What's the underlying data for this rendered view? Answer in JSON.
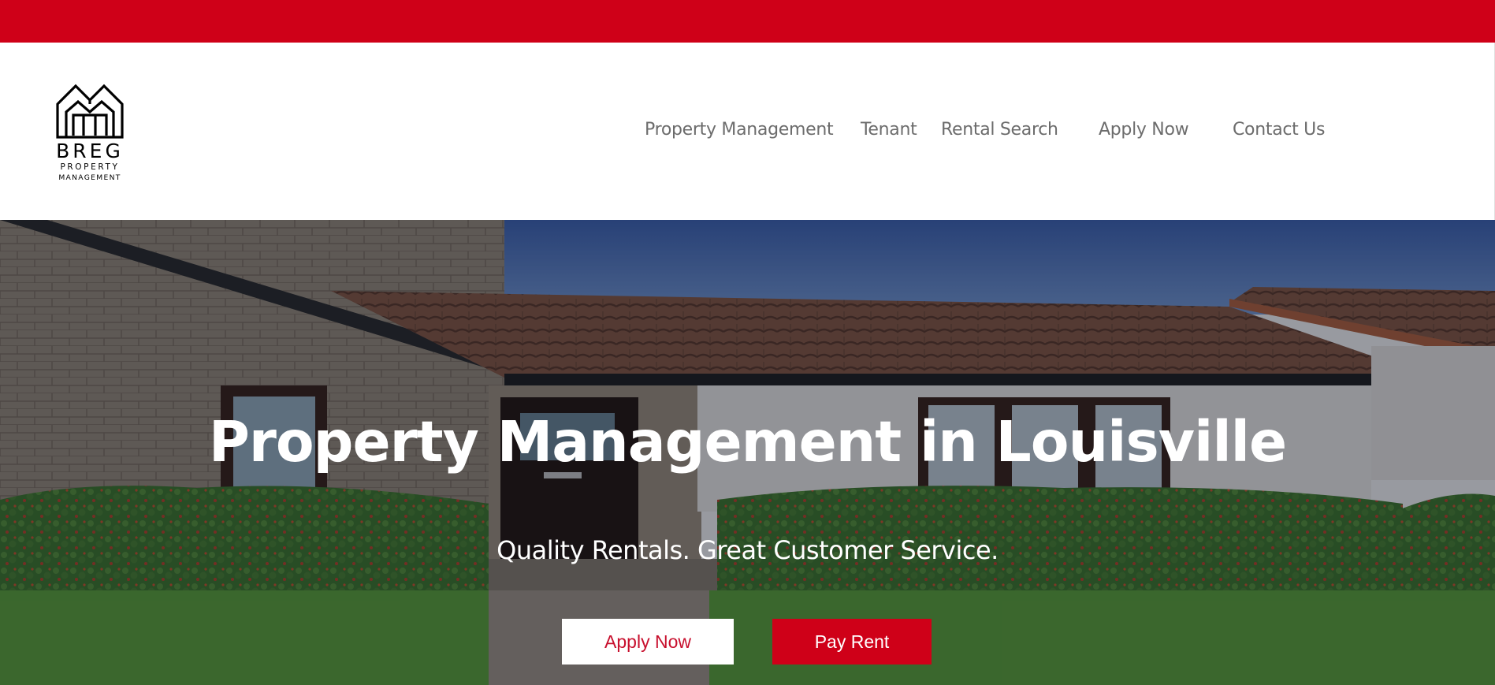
{
  "header": {
    "logo": {
      "brand": "BREG",
      "line2": "PROPERTY",
      "line3": "MANAGEMENT"
    },
    "nav": [
      {
        "label": "Property Management"
      },
      {
        "label": "Tenant"
      },
      {
        "label": "Rental Search"
      },
      {
        "label": "Apply Now"
      },
      {
        "label": "Contact Us"
      }
    ]
  },
  "hero": {
    "title": "Property Management in Louisville",
    "subtitle": "Quality Rentals. Great Customer Service.",
    "buttons": {
      "apply_label": "Apply Now",
      "pay_label": "Pay Rent"
    }
  },
  "colors": {
    "brand_red": "#cf0018",
    "nav_text": "#6c6c6c",
    "button_apply_text": "#c8102e"
  }
}
